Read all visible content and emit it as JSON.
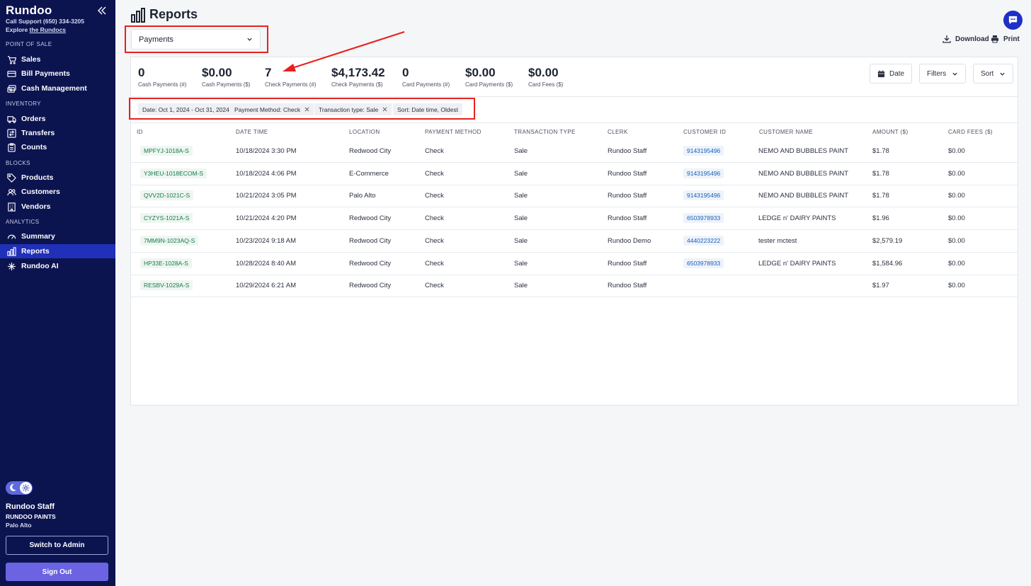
{
  "sidebar": {
    "brand": "Rundoo",
    "support_prefix": "Call Support (650) 334-3205",
    "explore_prefix": "Explore ",
    "explore_link": "the Rundocs",
    "sections": {
      "pos": "POINT OF SALE",
      "inventory": "INVENTORY",
      "blocks": "BLOCKS",
      "analytics": "ANALYTICS"
    },
    "items": {
      "sales": "Sales",
      "bill_payments": "Bill Payments",
      "cash_management": "Cash Management",
      "orders": "Orders",
      "transfers": "Transfers",
      "counts": "Counts",
      "products": "Products",
      "customers": "Customers",
      "vendors": "Vendors",
      "summary": "Summary",
      "reports": "Reports",
      "rundoo_ai": "Rundoo AI"
    },
    "user": {
      "name": "Rundoo Staff",
      "org": "RUNDOO PAINTS",
      "location": "Palo Alto"
    },
    "switch_admin": "Switch to Admin",
    "sign_out": "Sign Out"
  },
  "header": {
    "title": "Reports",
    "report_type": "Payments",
    "download": "Download",
    "print": "Print"
  },
  "stats": [
    {
      "value": "0",
      "label": "Cash Payments (#)"
    },
    {
      "value": "$0.00",
      "label": "Cash Payments ($)"
    },
    {
      "value": "7",
      "label": "Check Payments (#)"
    },
    {
      "value": "$4,173.42",
      "label": "Check Payments ($)"
    },
    {
      "value": "0",
      "label": "Card Payments (#)"
    },
    {
      "value": "$0.00",
      "label": "Card Payments ($)"
    },
    {
      "value": "$0.00",
      "label": "Card Fees ($)"
    }
  ],
  "controls": {
    "date": "Date",
    "filters": "Filters",
    "sort": "Sort"
  },
  "chips": [
    "Date: Oct 1, 2024 - Oct 31, 2024",
    "Payment Method: Check",
    "Transaction type: Sale",
    "Sort: Date time, Oldest"
  ],
  "table": {
    "columns": [
      "ID",
      "DATE TIME",
      "LOCATION",
      "PAYMENT METHOD",
      "TRANSACTION TYPE",
      "CLERK",
      "CUSTOMER ID",
      "CUSTOMER NAME",
      "AMOUNT ($)",
      "CARD FEES ($)"
    ],
    "rows": [
      {
        "id": "MPFYJ-1018A-S",
        "datetime": "10/18/2024 3:30 PM",
        "location": "Redwood City",
        "method": "Check",
        "type": "Sale",
        "clerk": "Rundoo Staff",
        "customer_id": "9143195496",
        "customer_name": "NEMO AND BUBBLES PAINT",
        "amount": "$1.78",
        "fees": "$0.00"
      },
      {
        "id": "Y3HEU-1018ECOM-S",
        "datetime": "10/18/2024 4:06 PM",
        "location": "E-Commerce",
        "method": "Check",
        "type": "Sale",
        "clerk": "Rundoo Staff",
        "customer_id": "9143195496",
        "customer_name": "NEMO AND BUBBLES PAINT",
        "amount": "$1.78",
        "fees": "$0.00"
      },
      {
        "id": "QVV2D-1021C-S",
        "datetime": "10/21/2024 3:05 PM",
        "location": "Palo Alto",
        "method": "Check",
        "type": "Sale",
        "clerk": "Rundoo Staff",
        "customer_id": "9143195496",
        "customer_name": "NEMO AND BUBBLES PAINT",
        "amount": "$1.78",
        "fees": "$0.00"
      },
      {
        "id": "CYZYS-1021A-S",
        "datetime": "10/21/2024 4:20 PM",
        "location": "Redwood City",
        "method": "Check",
        "type": "Sale",
        "clerk": "Rundoo Staff",
        "customer_id": "6503978933",
        "customer_name": "LEDGE n' DAIRY PAINTS",
        "amount": "$1.96",
        "fees": "$0.00"
      },
      {
        "id": "7MM9N-1023AQ-S",
        "datetime": "10/23/2024 9:18 AM",
        "location": "Redwood City",
        "method": "Check",
        "type": "Sale",
        "clerk": "Rundoo Demo",
        "customer_id": "4440223222",
        "customer_name": "tester mctest",
        "amount": "$2,579.19",
        "fees": "$0.00"
      },
      {
        "id": "HP33E-1028A-S",
        "datetime": "10/28/2024 8:40 AM",
        "location": "Redwood City",
        "method": "Check",
        "type": "Sale",
        "clerk": "Rundoo Staff",
        "customer_id": "6503978933",
        "customer_name": "LEDGE n' DAIRY PAINTS",
        "amount": "$1,584.96",
        "fees": "$0.00"
      },
      {
        "id": "RESBV-1029A-S",
        "datetime": "10/29/2024 6:21 AM",
        "location": "Redwood City",
        "method": "Check",
        "type": "Sale",
        "clerk": "Rundoo Staff",
        "customer_id": "",
        "customer_name": "",
        "amount": "$1.97",
        "fees": "$0.00"
      }
    ]
  },
  "colors": {
    "sidebar_bg": "#0c1450",
    "active_nav": "#2130b8",
    "sign_out": "#6c63e2",
    "annotation": "#e8211d",
    "id_chip_text": "#17794a",
    "customer_chip_text": "#1a5fb4"
  },
  "icons": {
    "collapse": "double-chevron-left-icon",
    "sales": "cart-icon",
    "bill_payments": "bill-icon",
    "cash_management": "cash-icon",
    "orders": "truck-icon",
    "transfers": "transfer-icon",
    "counts": "clipboard-icon",
    "products": "tag-icon",
    "customers": "people-icon",
    "vendors": "building-icon",
    "summary": "gauge-icon",
    "reports": "bar-chart-icon",
    "rundoo_ai": "sparkle-icon",
    "download": "download-icon",
    "print": "printer-icon",
    "chat": "chat-icon",
    "date": "calendar-icon"
  }
}
